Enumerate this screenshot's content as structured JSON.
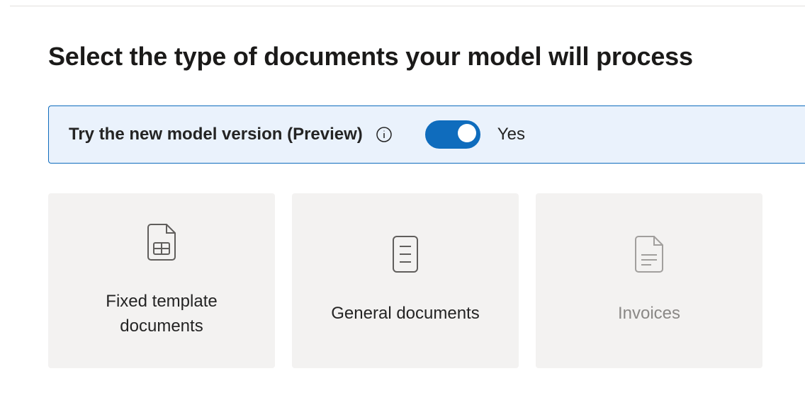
{
  "heading": "Select the type of documents your model will process",
  "banner": {
    "text": "Try the new model version (Preview)",
    "toggle_on": true,
    "toggle_label": "Yes"
  },
  "cards": [
    {
      "label": "Fixed template documents"
    },
    {
      "label": "General documents"
    },
    {
      "label": "Invoices"
    }
  ]
}
